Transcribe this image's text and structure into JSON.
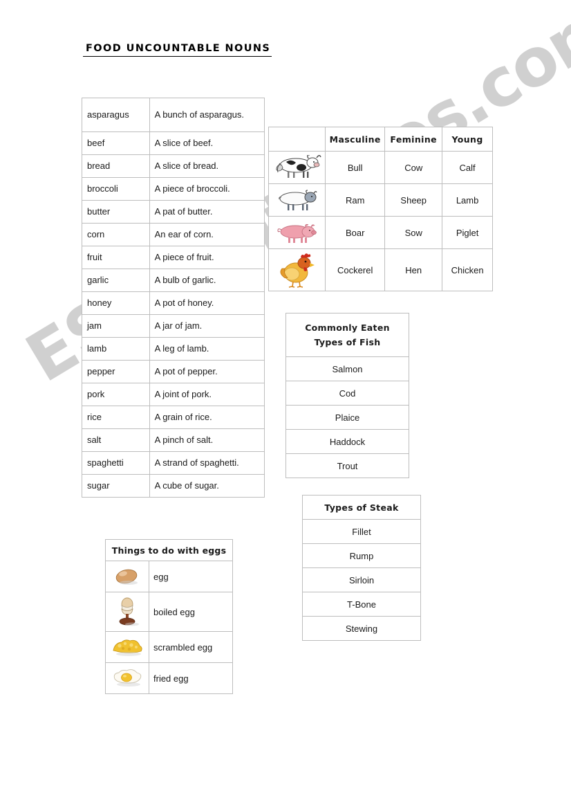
{
  "page": {
    "title": "FOOD  UNCOUNTABLE  NOUNS",
    "watermark": "ESLprintables.com",
    "background_color": "#ffffff",
    "border_color": "#bdbdbd",
    "text_color": "#1a1a1a"
  },
  "nouns_table": {
    "name": "uncountable-nouns-table",
    "rows": [
      {
        "word": "asparagus",
        "phrase": "A bunch of asparagus.",
        "tall": true
      },
      {
        "word": "beef",
        "phrase": "A slice of beef.",
        "tall": false
      },
      {
        "word": "bread",
        "phrase": "A slice of bread.",
        "tall": false
      },
      {
        "word": "broccoli",
        "phrase": "A piece of broccoli.",
        "tall": false
      },
      {
        "word": "butter",
        "phrase": "A pat of butter.",
        "tall": false
      },
      {
        "word": "corn",
        "phrase": "An ear of corn.",
        "tall": false
      },
      {
        "word": "fruit",
        "phrase": "A piece of fruit.",
        "tall": false
      },
      {
        "word": "garlic",
        "phrase": "A bulb of garlic.",
        "tall": false
      },
      {
        "word": "honey",
        "phrase": "A pot of honey.",
        "tall": false
      },
      {
        "word": "jam",
        "phrase": "A jar of jam.",
        "tall": false
      },
      {
        "word": "lamb",
        "phrase": "A leg of lamb.",
        "tall": false
      },
      {
        "word": "pepper",
        "phrase": "A pot of pepper.",
        "tall": false
      },
      {
        "word": "pork",
        "phrase": "A joint of pork.",
        "tall": false
      },
      {
        "word": "rice",
        "phrase": "A grain of rice.",
        "tall": false
      },
      {
        "word": "salt",
        "phrase": "A pinch of salt.",
        "tall": false
      },
      {
        "word": "spaghetti",
        "phrase": "A strand of spaghetti.",
        "tall": false
      },
      {
        "word": "sugar",
        "phrase": "A cube of sugar.",
        "tall": false
      }
    ]
  },
  "animals_table": {
    "name": "animal-genders-table",
    "headers": {
      "blank": "",
      "masculine": "Masculine",
      "feminine": "Feminine",
      "young": "Young"
    },
    "rows": [
      {
        "icon": "cow-icon",
        "masculine": "Bull",
        "feminine": "Cow",
        "young": "Calf"
      },
      {
        "icon": "sheep-icon",
        "masculine": "Ram",
        "feminine": "Sheep",
        "young": "Lamb"
      },
      {
        "icon": "pig-icon",
        "masculine": "Boar",
        "feminine": "Sow",
        "young": "Piglet"
      },
      {
        "icon": "chicken-icon",
        "masculine": "Cockerel",
        "feminine": "Hen",
        "young": "Chicken"
      }
    ]
  },
  "fish_table": {
    "name": "fish-types-table",
    "heading_line1": "Commonly Eaten",
    "heading_line2": "Types of Fish",
    "items": [
      "Salmon",
      "Cod",
      "Plaice",
      "Haddock",
      "Trout"
    ]
  },
  "steak_table": {
    "name": "steak-types-table",
    "heading": "Types of Steak",
    "items": [
      "Fillet",
      "Rump",
      "Sirloin",
      "T-Bone",
      "Stewing"
    ]
  },
  "eggs_table": {
    "name": "eggs-table",
    "heading": "Things to do with eggs",
    "rows": [
      {
        "icon": "whole-egg-icon",
        "label": "egg"
      },
      {
        "icon": "boiled-egg-icon",
        "label": "boiled egg"
      },
      {
        "icon": "scrambled-egg-icon",
        "label": "scrambled egg"
      },
      {
        "icon": "fried-egg-icon",
        "label": "fried egg"
      }
    ]
  }
}
